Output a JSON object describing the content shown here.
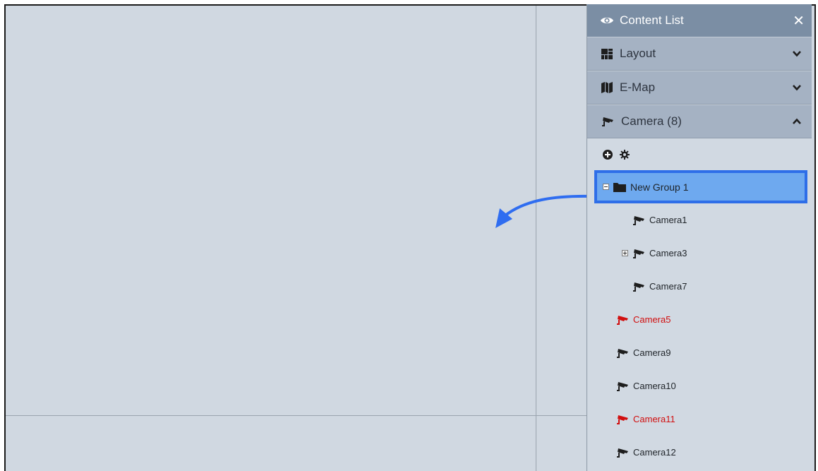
{
  "panel": {
    "title": "Content List",
    "close_glyph": "✕",
    "sections": [
      {
        "label": "Layout",
        "icon": "layout-icon",
        "state": "collapsed"
      },
      {
        "label": "E-Map",
        "icon": "map-icon",
        "state": "collapsed"
      },
      {
        "label": "Camera (8)",
        "icon": "camera-icon",
        "state": "expanded"
      }
    ],
    "toolbar": {
      "add_icon": "add-circle-icon",
      "settings_icon": "gear-icon"
    },
    "group": {
      "label": "New Group 1",
      "selected": true
    },
    "group_items": [
      {
        "label": "Camera1",
        "status": "normal",
        "has_children": false
      },
      {
        "label": "Camera3",
        "status": "normal",
        "has_children": true
      },
      {
        "label": "Camera7",
        "status": "normal",
        "has_children": false
      }
    ],
    "cameras": [
      {
        "label": "Camera5",
        "status": "offline"
      },
      {
        "label": "Camera9",
        "status": "normal"
      },
      {
        "label": "Camera10",
        "status": "normal"
      },
      {
        "label": "Camera11",
        "status": "offline"
      },
      {
        "label": "Camera12",
        "status": "normal"
      }
    ]
  },
  "colors": {
    "workspace_bg": "#d0d8e1",
    "header_bg": "#7b8ea4",
    "section_bg": "#a5b2c3",
    "selection_fill": "#6ea9ef",
    "selection_border": "#2e6ee8",
    "offline_red": "#d10f0f",
    "drag_arrow": "#2f6df0"
  }
}
